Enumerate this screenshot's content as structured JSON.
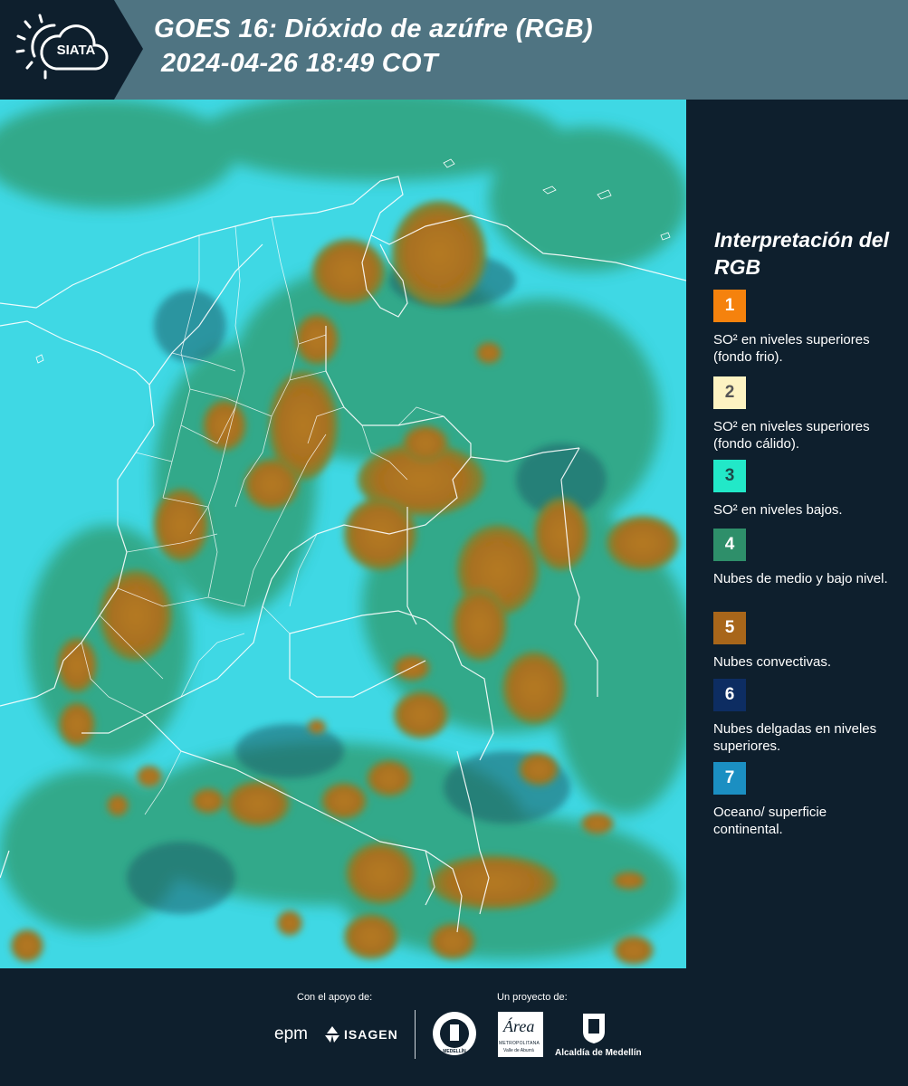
{
  "header": {
    "logo_text": "SIATA",
    "title_line1": "GOES 16: Dióxido de azúfre (RGB)",
    "title_line2": " 2024-04-26 18:49 COT"
  },
  "legend": {
    "title": "Interpretación del RGB",
    "items": [
      {
        "number": "1",
        "label": "SO² en niveles superiores (fondo frio).",
        "color": "#f5820d",
        "number_color": "#ffffff"
      },
      {
        "number": "2",
        "label": "SO² en niveles superiores (fondo cálido).",
        "color": "#fdf3c2",
        "number_color": "#555555"
      },
      {
        "number": "3",
        "label": "SO² en niveles bajos.",
        "color": "#22e8c8",
        "number_color": "#1c4a4a"
      },
      {
        "number": "4",
        "label": "Nubes de medio y bajo nivel.",
        "color": "#2e8f6a",
        "number_color": "#ffffff"
      },
      {
        "number": "5",
        "label": "Nubes convectivas.",
        "color": "#a8661a",
        "number_color": "#ffffff"
      },
      {
        "number": "6",
        "label": "Nubes delgadas en niveles superiores.",
        "color": "#0d2d62",
        "number_color": "#ffffff"
      },
      {
        "number": "7",
        "label": "Oceano/ superficie continental.",
        "color": "#1b8fc2",
        "number_color": "#ffffff"
      }
    ]
  },
  "footer": {
    "support_label": "Con el apoyo de:",
    "project_label": "Un proyecto de:",
    "sponsor_epm": "epm",
    "sponsor_isagen": "ISAGEN",
    "sponsor_area": "Área",
    "sponsor_area_sub": "METROPOLITANA",
    "sponsor_area_sub2": "Valle de Aburrá",
    "sponsor_medellin": "Alcaldía de Medellín",
    "seal_text": "MEDELLÍN"
  }
}
